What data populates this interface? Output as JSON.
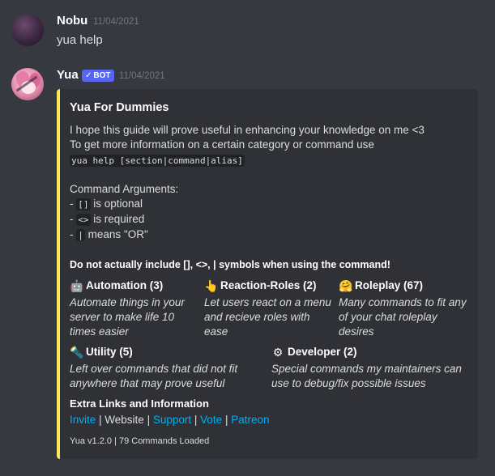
{
  "messages": [
    {
      "author": "Nobu",
      "timestamp": "11/04/2021",
      "content": "yua help"
    },
    {
      "author": "Yua",
      "badge": "BOT",
      "timestamp": "11/04/2021"
    }
  ],
  "embed": {
    "accent_color": "#fee75c",
    "title": "Yua For Dummies",
    "description_line1": "I hope this guide will prove useful in enhancing your knowledge on me <3",
    "description_line2": "To get more information on a certain category or command use",
    "usage_code": "yua help [section|command|alias]",
    "args_heading": "Command Arguments:",
    "args": [
      {
        "prefix": "- ",
        "code": "[]",
        "text": " is optional"
      },
      {
        "prefix": "- ",
        "code": "<>",
        "text": " is required"
      },
      {
        "prefix": "- ",
        "code": "|",
        "text": " means \"OR\""
      }
    ],
    "warning": "Do not actually include [], <>, | symbols when using the command!",
    "fields": [
      {
        "emoji": "🤖",
        "name": "Automation (3)",
        "value": "Automate things in your server to make life 10 times easier"
      },
      {
        "emoji": "👆",
        "name": "Reaction-Roles (2)",
        "value": "Let users react on a menu and recieve roles with ease"
      },
      {
        "emoji": "🤗",
        "name": "Roleplay (67)",
        "value": "Many commands to fit any of your chat roleplay desires"
      },
      {
        "emoji": "🔦",
        "name": "Utility (5)",
        "value": "Left over commands that did not fit anywhere that may prove useful"
      },
      {
        "emoji": "⚙",
        "name": "Developer (2)",
        "value": "Special commands my maintainers can use to debug/fix possible issues"
      }
    ],
    "links_heading": "Extra Links and Information",
    "links": {
      "invite": "Invite",
      "sep": " | ",
      "website": "Website",
      "support": "Support",
      "vote": "Vote",
      "patreon": "Patreon"
    },
    "footer": "Yua v1.2.0 | 79 Commands Loaded"
  },
  "colors": {
    "background": "#36393f",
    "embed_bg": "#2f3136",
    "link": "#00aff4",
    "bot_badge": "#5865f2"
  }
}
